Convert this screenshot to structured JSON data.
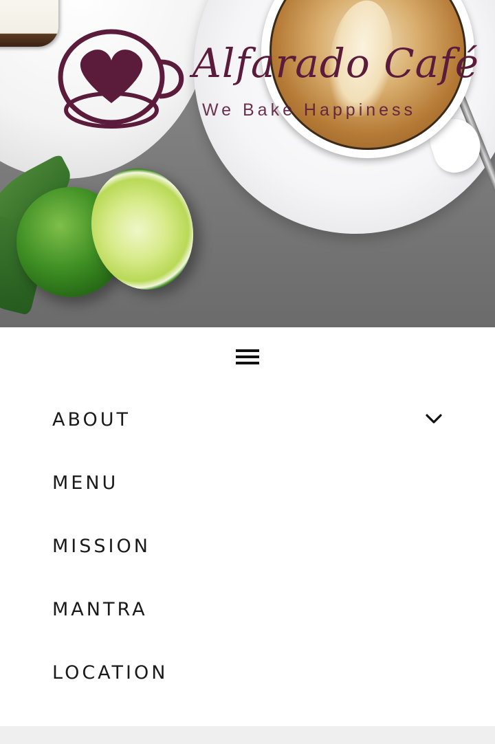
{
  "brand": {
    "name": "Alfarado Café",
    "tagline": "We Bake Happiness",
    "logo_color": "#5b1b3b"
  },
  "nav": {
    "toggle_icon": "hamburger-icon",
    "items": [
      {
        "label": "ABOUT",
        "has_submenu": true
      },
      {
        "label": "MENU",
        "has_submenu": false
      },
      {
        "label": "MISSION",
        "has_submenu": false
      },
      {
        "label": "MANTRA",
        "has_submenu": false
      },
      {
        "label": "LOCATION",
        "has_submenu": false
      }
    ]
  },
  "colors": {
    "text": "#1a1a1a",
    "background": "#ffffff",
    "footer": "#efefef"
  }
}
